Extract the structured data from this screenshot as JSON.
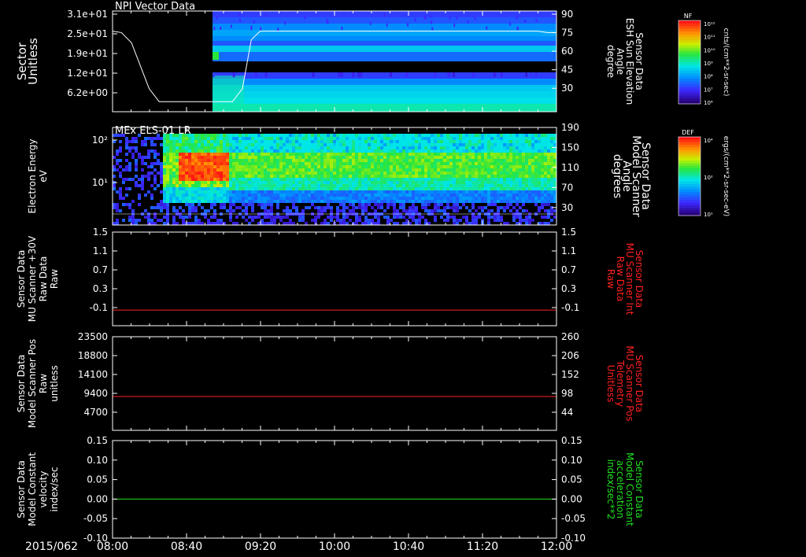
{
  "date_label": "2015/062",
  "x_ticks": [
    "08:00",
    "08:40",
    "09:20",
    "10:00",
    "10:40",
    "11:20",
    "12:00"
  ],
  "colors": {
    "axis": "#ffffff",
    "red": "#ff2020",
    "green": "#20e020",
    "bg": "#000000"
  },
  "chart_data": [
    {
      "type": "heatmap",
      "title": "NPI Vector Data",
      "ylabel_left": [
        "Sector",
        "Unitless"
      ],
      "left_ticks": [
        "3.1e+01",
        "2.5e+01",
        "1.9e+01",
        "1.2e+01",
        "6.2e+00"
      ],
      "ylabel_right": [
        "Sensor Data",
        "ESH Sun Elevation",
        "Angle",
        "degree"
      ],
      "right_ticks": [
        "90",
        "75",
        "60",
        "45",
        "30"
      ],
      "line_series": {
        "name": "ESH Sun Elevation Angle",
        "x_hours": [
          8.0,
          8.08,
          8.17,
          8.25,
          8.33,
          8.42,
          9.08,
          9.17,
          9.25,
          9.33,
          11.83,
          11.92,
          12.0
        ],
        "y_deg": [
          76,
          75,
          68,
          52,
          36,
          27,
          27,
          36,
          70,
          76,
          76,
          75,
          75
        ]
      },
      "colorbar": {
        "label": "NF",
        "units": "cnts/(cm**2-sr-sec)",
        "ticks": [
          "10¹²",
          "10¹¹",
          "10¹⁰",
          "10⁹",
          "10⁸",
          "10⁷",
          "10⁶"
        ]
      }
    },
    {
      "type": "heatmap",
      "title": "MEx ELS-01 LR",
      "ylabel_left": [
        "Electron Energy",
        "eV"
      ],
      "left_ticks": [
        "10²",
        "10¹"
      ],
      "ylabel_right": [
        "Sensor Data",
        "Model Scanner",
        "Angle",
        "degrees"
      ],
      "right_ticks": [
        "190",
        "150",
        "110",
        "70",
        "30"
      ],
      "colorbar": {
        "label": "DEF",
        "units": "ergs/(cm**2-sr-sec-eV)",
        "ticks": [
          "10⁴",
          "10²",
          "10¹"
        ]
      }
    },
    {
      "type": "line",
      "ylabel_left": [
        "Sensor Data",
        "MU Scanner +30V",
        "Raw Data",
        "Raw"
      ],
      "left_ticks": [
        "1.5",
        "1.1",
        "0.7",
        "0.3",
        "-0.1"
      ],
      "ylabel_right": [
        "Sensor Data",
        "MU Scanner Int",
        "Raw Data",
        "Raw"
      ],
      "right_ticks": [
        "1.5",
        "1.1",
        "0.7",
        "0.3",
        "-0.1"
      ],
      "ylim": [
        -0.3,
        1.5
      ],
      "series": [
        {
          "values_const": 0.0,
          "color": "red"
        }
      ]
    },
    {
      "type": "line",
      "ylabel_left": [
        "Sensor Data",
        "Model Scanner Pos",
        "Raw",
        "unitless"
      ],
      "left_ticks": [
        "23500",
        "18800",
        "14100",
        "9400",
        "4700"
      ],
      "ylabel_right": [
        "Sensor Data",
        "MU Scanner Pos",
        "Telemetry",
        "Unitless"
      ],
      "right_ticks": [
        "260",
        "206",
        "152",
        "98",
        "44"
      ],
      "ylim": [
        0,
        23500
      ],
      "series": [
        {
          "values_const": 8500,
          "color": "red"
        }
      ]
    },
    {
      "type": "line",
      "ylabel_left": [
        "Sensor Data",
        "Model Constant",
        "velocity",
        "index/sec"
      ],
      "left_ticks": [
        "0.15",
        "0.10",
        "0.05",
        "0.00",
        "-0.05",
        "-0.10"
      ],
      "ylabel_right": [
        "Sensor Data",
        "Model Constant",
        "acceleration",
        "index/sec**2"
      ],
      "right_ticks": [
        "0.15",
        "0.10",
        "0.05",
        "0.00",
        "-0.05",
        "-0.10"
      ],
      "ylim": [
        -0.1,
        0.15
      ],
      "series": [
        {
          "values_const": 0.0,
          "color": "green"
        }
      ]
    }
  ]
}
